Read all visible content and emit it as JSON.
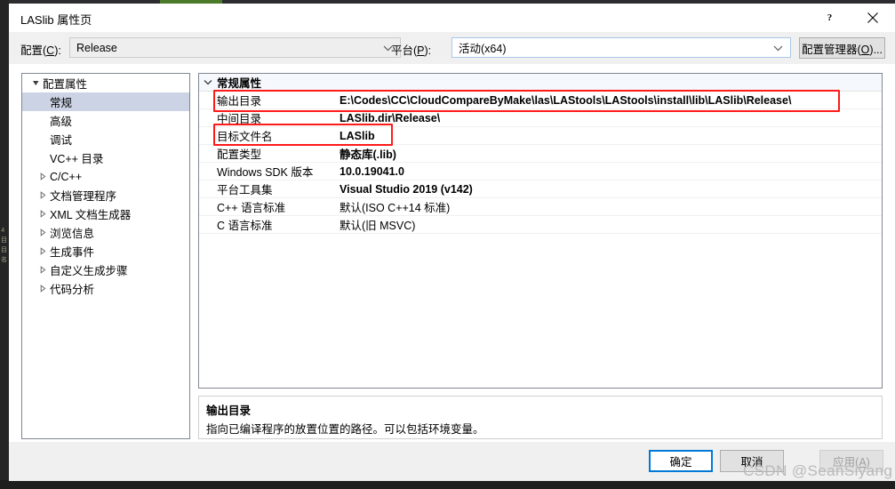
{
  "window": {
    "title": "LASlib 属性页",
    "help_icon": "question-mark-icon",
    "close_icon": "close-x-icon"
  },
  "configbar": {
    "config_label": "配置(C):",
    "config_value": "Release",
    "platform_label": "平台(P):",
    "platform_value": "活动(x64)",
    "config_manager_button": "配置管理器(O)..."
  },
  "tree": {
    "items": [
      {
        "label": "配置属性",
        "depth": 0,
        "twisty": "expanded",
        "selected": false
      },
      {
        "label": "常规",
        "depth": 1,
        "twisty": "none",
        "selected": true
      },
      {
        "label": "高级",
        "depth": 1,
        "twisty": "none",
        "selected": false
      },
      {
        "label": "调试",
        "depth": 1,
        "twisty": "none",
        "selected": false
      },
      {
        "label": "VC++ 目录",
        "depth": 1,
        "twisty": "none",
        "selected": false
      },
      {
        "label": "C/C++",
        "depth": 1,
        "twisty": "collapsed",
        "selected": false
      },
      {
        "label": "文档管理程序",
        "depth": 1,
        "twisty": "collapsed",
        "selected": false
      },
      {
        "label": "XML 文档生成器",
        "depth": 1,
        "twisty": "collapsed",
        "selected": false
      },
      {
        "label": "浏览信息",
        "depth": 1,
        "twisty": "collapsed",
        "selected": false
      },
      {
        "label": "生成事件",
        "depth": 1,
        "twisty": "collapsed",
        "selected": false
      },
      {
        "label": "自定义生成步骤",
        "depth": 1,
        "twisty": "collapsed",
        "selected": false
      },
      {
        "label": "代码分析",
        "depth": 1,
        "twisty": "collapsed",
        "selected": false
      }
    ]
  },
  "grid": {
    "category": "常规属性",
    "rows": [
      {
        "name": "输出目录",
        "value": "E:\\Codes\\CC\\CloudCompareByMake\\las\\LAStools\\LAStools\\install\\lib\\LASlib\\Release\\",
        "bold": true
      },
      {
        "name": "中间目录",
        "value": "LASlib.dir\\Release\\",
        "bold": true
      },
      {
        "name": "目标文件名",
        "value": "LASlib",
        "bold": true
      },
      {
        "name": "配置类型",
        "value": "静态库(.lib)",
        "bold": true
      },
      {
        "name": "Windows SDK 版本",
        "value": "10.0.19041.0",
        "bold": true
      },
      {
        "name": "平台工具集",
        "value": "Visual Studio 2019 (v142)",
        "bold": true
      },
      {
        "name": "C++ 语言标准",
        "value": "默认(ISO C++14 标准)",
        "bold": false
      },
      {
        "name": "C 语言标准",
        "value": "默认(旧 MSVC)",
        "bold": false
      }
    ]
  },
  "description": {
    "title": "输出目录",
    "text": "指向已编译程序的放置位置的路径。可以包括环境变量。"
  },
  "footer": {
    "ok": "确定",
    "cancel": "取消",
    "apply": "应用(A)"
  },
  "watermark": "CSDN @SeanSiyang",
  "colors": {
    "accent": "#0078d7",
    "annotation": "#ff1a1a",
    "selection": "#cbd3e4"
  }
}
